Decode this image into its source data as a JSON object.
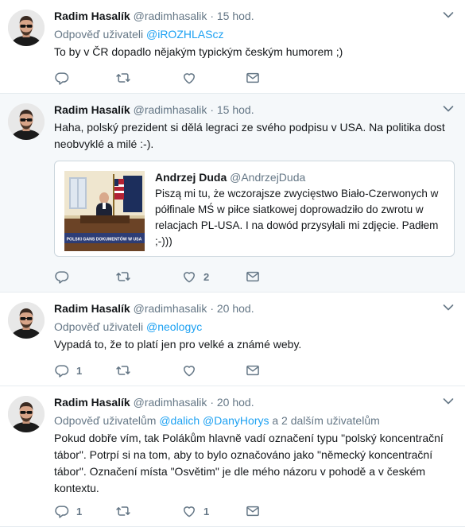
{
  "colors": {
    "accent": "#1da1f2",
    "muted": "#657786",
    "border": "#e6ecf0",
    "highlight_bg": "#f5f8fa"
  },
  "tweets": [
    {
      "name": "Radim Hasalík",
      "handle": "@radimhasalik",
      "dot": "·",
      "time": "15 hod.",
      "replying_prefix": "Odpověď uživateli",
      "mention1": "@iROZHLAScz",
      "text": "To by v ČR dopadlo nějakým typickým českým humorem ;)",
      "reply_count": "",
      "retweet_count": "",
      "like_count": ""
    },
    {
      "name": "Radim Hasalík",
      "handle": "@radimhasalik",
      "dot": "·",
      "time": "15 hod.",
      "text": "Haha, polský prezident si dělá legraci ze svého podpisu v USA. Na politika dost neobvyklé a milé :-).",
      "quote": {
        "name": "Andrzej Duda",
        "handle": "@AndrzejDuda",
        "text": "Piszą mi tu, że wczorajsze zwycięstwo Biało-Czerwonych w półfinale MŚ w piłce siatkowej doprowadziło do zwrotu w relacjach PL-USA. I na dowód przysyłali mi zdjęcie. Padłem ;-)))",
        "image_caption": "POLSKI GANS DOKUMENTÓW W USA"
      },
      "reply_count": "",
      "retweet_count": "",
      "like_count": "2"
    },
    {
      "name": "Radim Hasalík",
      "handle": "@radimhasalik",
      "dot": "·",
      "time": "20 hod.",
      "replying_prefix": "Odpověď uživateli",
      "mention1": "@neologyc",
      "text": "Vypadá to, že to platí jen pro velké a známé weby.",
      "reply_count": "1",
      "retweet_count": "",
      "like_count": ""
    },
    {
      "name": "Radim Hasalík",
      "handle": "@radimhasalik",
      "dot": "·",
      "time": "20 hod.",
      "replying_prefix": "Odpověď uživatelům",
      "mention1": "@dalich",
      "mention2": "@DanyHorys",
      "replying_suffix": "a 2 dalším uživatelům",
      "text": "Pokud dobře vím, tak Polákům hlavně vadí označení typu \"polský koncentrační tábor\". Potrpí si na tom, aby to bylo označováno jako \"německý koncentrační tábor\". Označení místa \"Osvětim\" je dle mého názoru v pohodě a v českém kontextu.",
      "reply_count": "1",
      "retweet_count": "",
      "like_count": "1"
    }
  ]
}
